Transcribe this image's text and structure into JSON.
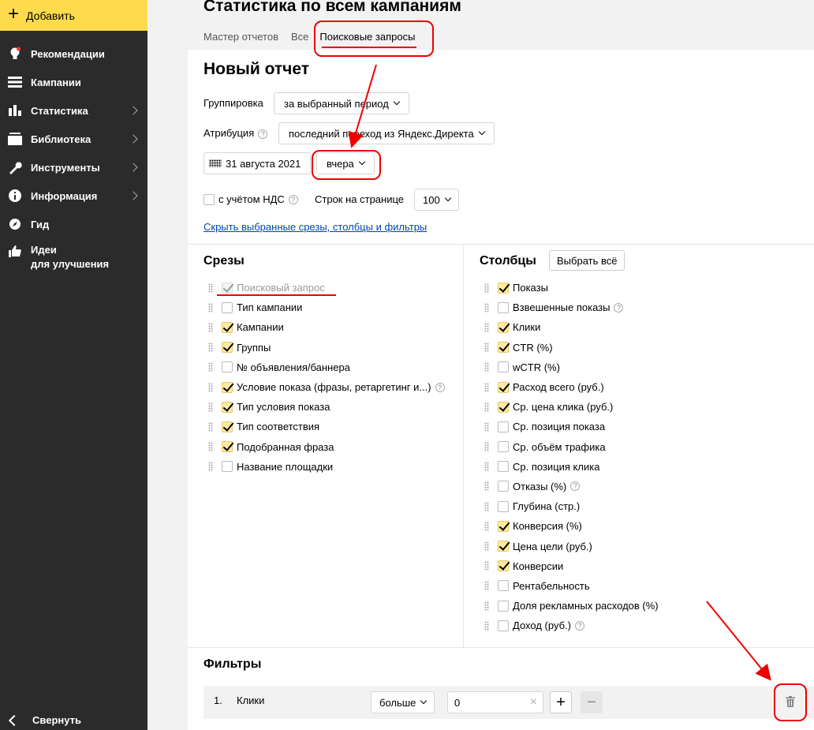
{
  "sidebar": {
    "add_label": "Добавить",
    "items": [
      {
        "label": "Рекомендации",
        "icon": "lightbulb-icon",
        "has_arrow": false
      },
      {
        "label": "Кампании",
        "icon": "menu-icon",
        "has_arrow": false
      },
      {
        "label": "Статистика",
        "icon": "bar-chart-icon",
        "has_arrow": true
      },
      {
        "label": "Библиотека",
        "icon": "library-icon",
        "has_arrow": true
      },
      {
        "label": "Инструменты",
        "icon": "wrench-icon",
        "has_arrow": true
      },
      {
        "label": "Информация",
        "icon": "info-icon",
        "has_arrow": true
      },
      {
        "label": "Гид",
        "icon": "compass-icon",
        "has_arrow": false
      }
    ],
    "ideas_line1": "Идеи",
    "ideas_line2": "для улучшения",
    "collapse_label": "Свернуть"
  },
  "header": {
    "title": "Статистика по всем кампаниям",
    "tabs": [
      {
        "label": "Мастер отчетов"
      },
      {
        "label": "Все"
      },
      {
        "label": "Поисковые запросы",
        "active": true
      }
    ]
  },
  "report": {
    "title": "Новый отчет",
    "grouping_label": "Группировка",
    "grouping_value": "за выбранный период",
    "attribution_label": "Атрибуция",
    "attribution_value": "последний переход из Яндекс.Директа",
    "date_value": "31 августа 2021",
    "period_value": "вчера",
    "vat_label": "с учётом НДС",
    "vat_checked": false,
    "rows_label": "Строк на странице",
    "rows_value": "100",
    "hide_link": "Скрыть выбранные срезы, столбцы и фильтры"
  },
  "slices": {
    "title": "Срезы",
    "items": [
      {
        "label": "Поисковый запрос",
        "checked": true,
        "disabled": true,
        "help": false
      },
      {
        "label": "Тип кампании",
        "checked": false,
        "help": false
      },
      {
        "label": "Кампании",
        "checked": true,
        "help": false
      },
      {
        "label": "Группы",
        "checked": true,
        "help": false
      },
      {
        "label": "№ объявления/баннера",
        "checked": false,
        "help": false
      },
      {
        "label": "Условие показа (фразы, ретаргетинг и...)",
        "checked": true,
        "help": true
      },
      {
        "label": "Тип условия показа",
        "checked": true,
        "help": false
      },
      {
        "label": "Тип соответствия",
        "checked": true,
        "help": false
      },
      {
        "label": "Подобранная фраза",
        "checked": true,
        "help": false
      },
      {
        "label": "Название площадки",
        "checked": false,
        "help": false
      }
    ]
  },
  "columns": {
    "title": "Столбцы",
    "select_all": "Выбрать всё",
    "items": [
      {
        "label": "Показы",
        "checked": true,
        "help": false
      },
      {
        "label": "Взвешенные показы",
        "checked": false,
        "help": true
      },
      {
        "label": "Клики",
        "checked": true,
        "help": false
      },
      {
        "label": "CTR (%)",
        "checked": true,
        "help": false
      },
      {
        "label": "wCTR (%)",
        "checked": false,
        "help": false
      },
      {
        "label": "Расход всего (руб.)",
        "checked": true,
        "help": false
      },
      {
        "label": "Ср. цена клика (руб.)",
        "checked": true,
        "help": false
      },
      {
        "label": "Ср. позиция показа",
        "checked": false,
        "help": false
      },
      {
        "label": "Ср. объём трафика",
        "checked": false,
        "help": false
      },
      {
        "label": "Ср. позиция клика",
        "checked": false,
        "help": false
      },
      {
        "label": "Отказы (%)",
        "checked": false,
        "help": true
      },
      {
        "label": "Глубина (стр.)",
        "checked": false,
        "help": false
      },
      {
        "label": "Конверсия (%)",
        "checked": true,
        "help": false
      },
      {
        "label": "Цена цели (руб.)",
        "checked": true,
        "help": false
      },
      {
        "label": "Конверсии",
        "checked": true,
        "help": false
      },
      {
        "label": "Рентабельность",
        "checked": false,
        "help": false
      },
      {
        "label": "Доля рекламных расходов (%)",
        "checked": false,
        "help": false
      },
      {
        "label": "Доход (руб.)",
        "checked": false,
        "help": true
      }
    ]
  },
  "filters": {
    "title": "Фильтры",
    "rows": [
      {
        "num": "1.",
        "field": "Клики",
        "operator": "больше",
        "value": "0"
      }
    ]
  },
  "colors": {
    "accent_yellow": "#fedb4d",
    "sidebar_bg": "#2b2b2b",
    "link": "#0044bb",
    "annotation": "#ee0000"
  }
}
